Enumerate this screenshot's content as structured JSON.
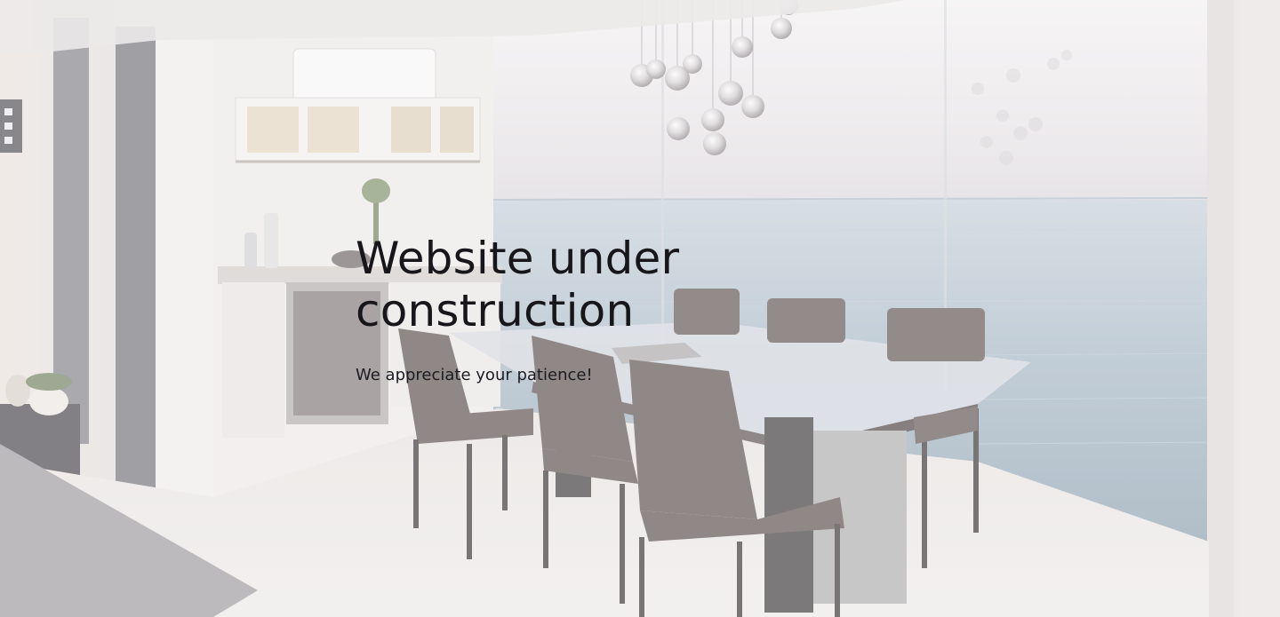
{
  "page": {
    "headline_line1": "Website under",
    "headline_line2": "construction",
    "subline": "We appreciate your patience!"
  },
  "background": {
    "scene": "dining-room-ocean-view-photo"
  },
  "colors": {
    "text": "#16161b",
    "overlay": "#f6f4f3"
  }
}
